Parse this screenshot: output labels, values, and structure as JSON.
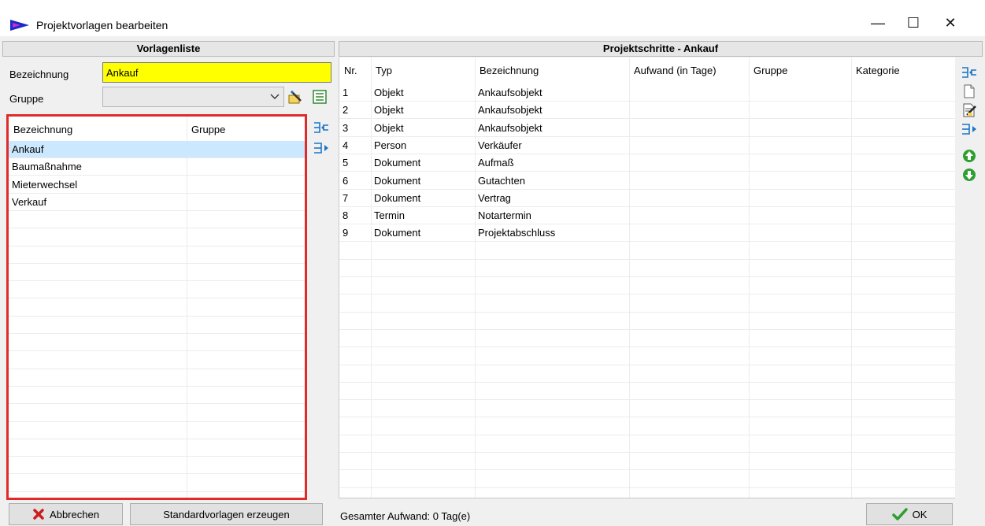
{
  "window": {
    "title": "Projektvorlagen bearbeiten",
    "minimize_glyph": "—",
    "maximize_glyph": "☐",
    "close_glyph": "✕"
  },
  "left_panel": {
    "header": "Vorlagenliste",
    "bezeichnung_label": "Bezeichnung",
    "bezeichnung_value": "Ankauf",
    "gruppe_label": "Gruppe",
    "gruppe_value": "",
    "table": {
      "columns": [
        "Bezeichnung",
        "Gruppe"
      ],
      "rows": [
        [
          "Ankauf",
          ""
        ],
        [
          "Baumaßnahme",
          ""
        ],
        [
          "Mieterwechsel",
          ""
        ],
        [
          "Verkauf",
          ""
        ]
      ],
      "selected_index": 0
    }
  },
  "right_panel": {
    "header": "Projektschritte - Ankauf",
    "table": {
      "columns": [
        "Nr.",
        "Typ",
        "Bezeichnung",
        "Aufwand (in Tage)",
        "Gruppe",
        "Kategorie"
      ],
      "rows": [
        [
          "1",
          "Objekt",
          "Ankaufsobjekt",
          "",
          "",
          ""
        ],
        [
          "2",
          "Objekt",
          "Ankaufsobjekt",
          "",
          "",
          ""
        ],
        [
          "3",
          "Objekt",
          "Ankaufsobjekt",
          "",
          "",
          ""
        ],
        [
          "4",
          "Person",
          "Verkäufer",
          "",
          "",
          ""
        ],
        [
          "5",
          "Dokument",
          "Aufmaß",
          "",
          "",
          ""
        ],
        [
          "6",
          "Dokument",
          "Gutachten",
          "",
          "",
          ""
        ],
        [
          "7",
          "Dokument",
          "Vertrag",
          "",
          "",
          ""
        ],
        [
          "8",
          "Termin",
          "Notartermin",
          "",
          "",
          ""
        ],
        [
          "9",
          "Dokument",
          "Projektabschluss",
          "",
          "",
          ""
        ]
      ]
    }
  },
  "footer": {
    "cancel_label": "Abbrechen",
    "standard_label": "Standardvorlagen erzeugen",
    "total_text": "Gesamter Aufwand: 0 Tag(e)",
    "ok_label": "OK"
  },
  "colors": {
    "highlight_input": "#ffff00",
    "selection_row": "#cce8ff",
    "focus_border": "#e02b2b",
    "arrow_green": "#2e9e2e",
    "cancel_red": "#cc1d1d",
    "title_icon_blue": "#1b28c8"
  }
}
